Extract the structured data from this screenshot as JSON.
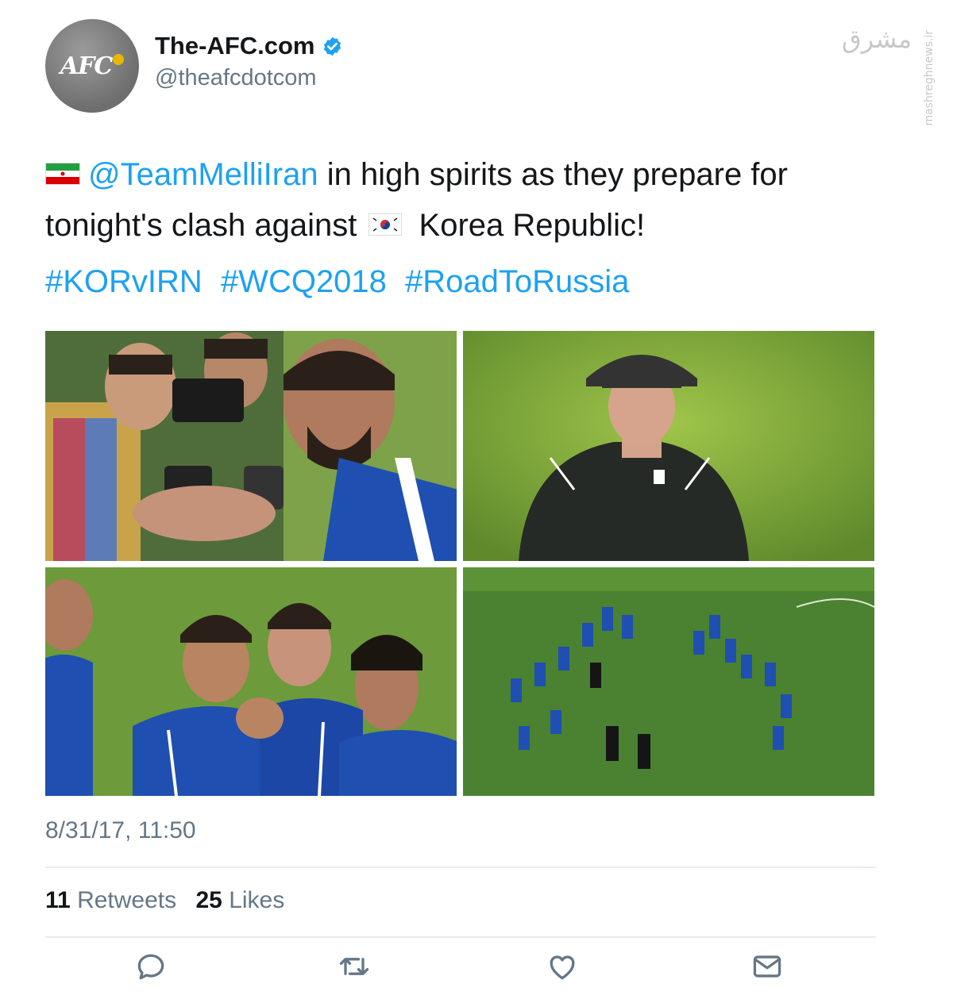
{
  "account": {
    "display_name": "The-AFC.com",
    "handle": "@theafcdotcom",
    "avatar_text": "AFC",
    "verified": true
  },
  "watermark": {
    "logo_text": "مشرق",
    "site_text": "mashreghnews.ir"
  },
  "tweet": {
    "mention": "@TeamMelliIran",
    "text_part1": " in high spirits as they prepare for tonight's clash against ",
    "text_part2": " Korea Republic!",
    "hashtags": [
      "#KORvIRN",
      "#WCQ2018",
      "#RoadToRussia"
    ],
    "timestamp": "8/31/17, 11:50"
  },
  "media": {
    "photos": [
      "player-interviewed-by-fans",
      "coach-in-cap-on-pitch",
      "players-celebrating",
      "team-training-on-field"
    ]
  },
  "stats": {
    "retweets_count": "11",
    "retweets_label": "Retweets",
    "likes_count": "25",
    "likes_label": "Likes"
  },
  "actions": [
    "reply-icon",
    "retweet-icon",
    "like-icon",
    "direct-message-icon"
  ],
  "colors": {
    "link": "#1da1f2",
    "text": "#14171a",
    "muted": "#657786",
    "divider": "#e6ecf0"
  }
}
